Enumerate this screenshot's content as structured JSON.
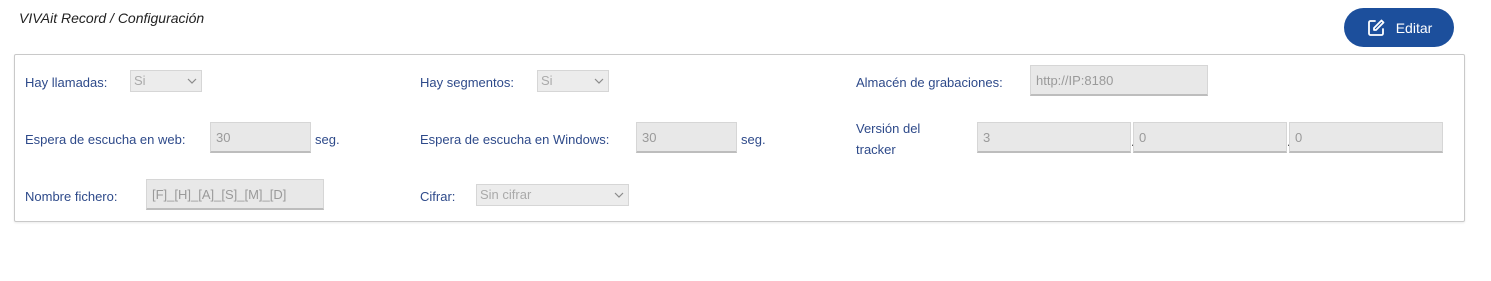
{
  "breadcrumb": "VIVAit Record / Configuración",
  "toolbar": {
    "edit_label": "Editar"
  },
  "form": {
    "calls_label": "Hay llamadas:",
    "calls_value": "Si",
    "segments_label": "Hay segmentos:",
    "segments_value": "Si",
    "storage_label": "Almacén de grabaciones:",
    "storage_value": "http://IP:8180",
    "web_wait_label": "Espera de escucha en web:",
    "web_wait_value": "30",
    "web_wait_unit": "seg.",
    "windows_wait_label": "Espera de escucha en Windows:",
    "windows_wait_value": "30",
    "windows_wait_unit": "seg.",
    "tracker_version_label_line1": "Versión del",
    "tracker_version_label_line2": "tracker",
    "tracker_version_major": "3",
    "tracker_version_minor": "0",
    "tracker_version_patch": "0",
    "version_separator": ".",
    "filename_label": "Nombre fichero:",
    "filename_value": "[F]_[H]_[A]_[S]_[M]_[D]",
    "encrypt_label": "Cifrar:",
    "encrypt_value": "Sin cifrar"
  },
  "colors": {
    "accent": "#1c4f9c",
    "label": "#2e4a8a",
    "field_bg": "#e8e8e8"
  },
  "icons": {
    "edit": "pencil-square-icon",
    "chevron": "chevron-down-icon"
  }
}
